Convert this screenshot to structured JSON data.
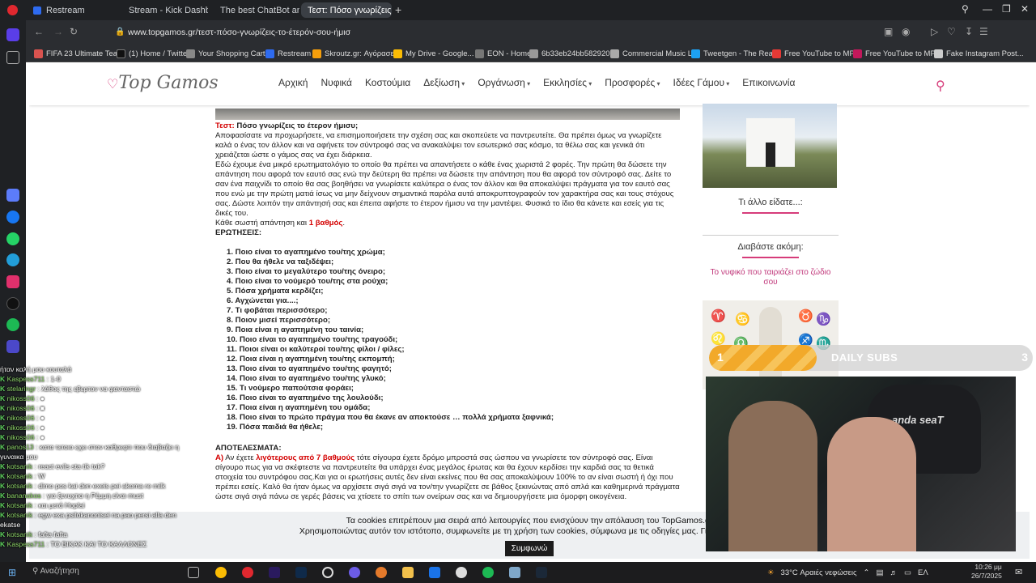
{
  "browser": {
    "tabs": [
      {
        "label": "Restream",
        "color": "#2e6bf0"
      },
      {
        "label": "Stream - Kick Dashboard",
        "color": "#53fc18"
      },
      {
        "label": "The best ChatBot and Wi",
        "color": "#ffffff"
      },
      {
        "label": "Τεστ: Πόσο γνωρίζεις το",
        "color": "#e33e7a"
      }
    ],
    "new_tab_glyph": "+",
    "url": "www.topgamos.gr/τεστ-πόσο-γνωρίζεις-το-έτερόν-σου-ήμισ",
    "bookmarks": [
      {
        "label": "FIFA 23 Ultimate Tea...",
        "color": "#d9534f"
      },
      {
        "label": "(1) Home / Twitter",
        "color": "#111111"
      },
      {
        "label": "Your Shopping Cart...",
        "color": "#888888"
      },
      {
        "label": "Restream",
        "color": "#2e6bf0"
      },
      {
        "label": "Skroutz.gr: Αγόρασε...",
        "color": "#f59e0b"
      },
      {
        "label": "My Drive - Google...",
        "color": "#fbbc04"
      },
      {
        "label": "EON - Home",
        "color": "#777777"
      },
      {
        "label": "6b33eb24bb582920...",
        "color": "#999999"
      },
      {
        "label": "Commercial Music L...",
        "color": "#aaaaaa"
      },
      {
        "label": "Tweetgen - The Real...",
        "color": "#1da1f2"
      },
      {
        "label": "Free YouTube to MP...",
        "color": "#e53935"
      },
      {
        "label": "Free YouTube to MP...",
        "color": "#c2185b"
      },
      {
        "label": "Fake Instagram Post...",
        "color": "#cccccc"
      }
    ]
  },
  "site": {
    "logo": "Top Gamos",
    "nav": [
      "Αρχική",
      "Νυφικά",
      "Κοστούμια",
      "Δεξίωση",
      "Οργάνωση",
      "Εκκλησίες",
      "Προσφορές",
      "Ιδέες Γάμου",
      "Επικοινωνία"
    ],
    "article": {
      "title_prefix": "Τεστ:",
      "title": "Πόσο γνωρίζεις το έτερον ήμισυ;",
      "paragraph1": "Αποφασίσατε να προχωρήσετε, να επισημοποιήσετε την σχέση σας και σκοπεύετε να παντρευτείτε. Θα πρέπει όμως να γνωρίζετε καλά ο ένας τον άλλον και να αφήνετε τον σύντροφό σας να ανακαλύψει τον εσωτερικό σας κόσμο, τα θέλω σας και γενικά ότι χρειάζεται ώστε ο γάμος σας να έχει διάρκεια.",
      "paragraph2": "Εδώ έχουμε ένα μικρό ερωτηματολόγιο το οποίο θα πρέπει να απαντήσετε ο κάθε ένας χωριστά 2 φορές. Την πρώτη θα δώσετε την απάντηση που αφορά τον εαυτό σας ενώ την δεύτερη θα πρέπει να δώσετε την απάντηση που θα αφορά τον σύντροφό σας. Δείτε το σαν ένα παιχνίδι το οποίο θα σας βοηθήσει να γνωρίσετε καλύτερα ο ένας τον άλλον και θα αποκαλύψει πράγματα για τον εαυτό σας που ενώ με την πρώτη ματιά ίσως να μην δείχνουν σημαντικά παρόλα αυτά αποκρυπτογραφούν τον χαρακτήρα σας και τους στόχους σας. Δώστε λοιπόν την απάντησή σας και έπειτα αφήστε το έτερον ήμισυ να την μαντέψει. Φυσικά το ίδιο θα κάνετε και εσείς για τις δικές του.",
      "score_text": "Κάθε σωστή απάντηση και",
      "score_value": "1 βαθμός",
      "score_end": ".",
      "questions_heading": "ΕΡΩΤΗΣΕΙΣ:",
      "questions": [
        "Ποιο είναι το αγαπημένο του/της χρώμα;",
        "Που θα ήθελε να ταξιδέψει;",
        "Ποιο είναι το μεγαλύτερο του/της όνειρο;",
        "Ποιο είναι το νούμερό του/της στα ρούχα;",
        "Πόσα χρήματα κερδίζει;",
        "Αγχώνεται για....;",
        "Τι φοβάται περισσότερο;",
        "Ποιον μισεί περισσότερο;",
        "Ποια είναι η αγαπημένη του ταινία;",
        "Ποιο είναι το αγαπημένο του/της τραγούδι;",
        "Ποιοι είναι οι καλύτεροί του/της φίλοι / φίλες;",
        "Ποια είναι η αγαπημένη του/της εκπομπή;",
        "Ποιο είναι το αγαπημένο του/της φαγητό;",
        "Ποιο είναι το αγαπημένο του/της γλυκό;",
        "Τι νούμερο παπούτσια φοράει;",
        "Ποιο είναι το αγαπημένο της λουλούδι;",
        "Ποια είναι η αγαπημένη του ομάδα;",
        "Ποιο είναι το πρώτο πράγμα που θα έκανε αν αποκτούσε … πολλά χρήματα ξαφνικά;",
        "Πόσα παιδιά θα ήθελε;"
      ],
      "results_heading": "ΑΠΟΤΕΛΕΣΜΑΤΑ:",
      "result_a_label": "Α)",
      "result_a_pre": "Αν έχετε",
      "result_a_highlight": "λιγότερους από 7 βαθμούς",
      "result_a_text": "τότε σίγουρα έχετε δρόμο μπροστά σας ώσπου να γνωρίσετε τον σύντροφό σας. Είναι σίγουρο πως για να σκέφτεστε να παντρευτείτε θα υπάρχει ένας μεγάλος έρωτας και θα έχουν κερδίσει την καρδιά σας τα θετικά στοιχεία του συντρόφου σας.Και για οι ερωτήσεις αυτές δεν είναι εκείνες που θα σας αποκαλύψουν 100% το αν είναι σωστή ή όχι που πρέπει εσείς. Καλό θα ήταν όμως να αρχίσετε σιγά σιγά να τον/την γνωρίζετε σε βάθος ξεκινώντας από απλά και καθημερινά πράγματα ώστε σιγά σιγά πάνω σε γερές βάσεις να χτίσετε το σπίτι των ονείρων σας και να δημιουργήσετε μια όμορφη οικογένεια."
    },
    "sidebar": {
      "other_title": "Τι άλλο είδατε...:",
      "read_more_title": "Διαβάστε ακόμη:",
      "read_more_link": "Το νυφικό που ταιριάζει στο ζώδιο σου"
    },
    "cookie_text_1": "Τα cookies επιτρέπουν μια σειρά από λειτουργίες που ενισχύουν την απόλαυση του TopGamos.gr",
    "cookie_text_2": "Χρησιμοποιώντας αυτόν τον ιστότοπο, συμφωνείτε με τη χρήση των cookies, σύμφωνα με τις οδηγίες μας. Για να μάθετε π",
    "cookie_accept": "Συμφωνώ"
  },
  "overlay": {
    "subs_current": "1",
    "subs_label": "DAILY SUBS",
    "subs_goal": "3",
    "subs_fraction": 0.333,
    "webcam_chair_brand": "anda seaT",
    "chat": [
      {
        "user": "",
        "text": "ήταν καλή μου κουταλά"
      },
      {
        "user": "Kaspess711",
        "text": "1-0"
      },
      {
        "user": "stelaringr",
        "text": "λάθος της εβερτον να φανταστώ"
      },
      {
        "user": "nikoss06",
        "text": "●"
      },
      {
        "user": "nikoss06",
        "text": "■"
      },
      {
        "user": "nikoss06",
        "text": "●"
      },
      {
        "user": "nikoss06",
        "text": "●"
      },
      {
        "user": "nikoss06",
        "text": "●"
      },
      {
        "user": "panos13",
        "text": "κατα τετοιο εχει στον καθρεφτι που διαβαζει η γυναικα μου"
      },
      {
        "user": "kotsanik",
        "text": "react evils sta tik tok?"
      },
      {
        "user": "kotsanik",
        "text": "W"
      },
      {
        "user": "kotsanik",
        "text": "dimo pos kai den exeis pei akoma re milk"
      },
      {
        "user": "bananakos",
        "text": "για ξενυχτια η Ρέμμη είναι must"
      },
      {
        "user": "kotsanik",
        "text": "και μετά Hoplai"
      },
      {
        "user": "kotsanik",
        "text": "egw exa psilokanonisei na pao persi alla den ekatse"
      },
      {
        "user": "kotsanik",
        "text": "fafta fafta"
      },
      {
        "user": "Kaspess711",
        "text": "ΤΟ ΒΙΚΑΚ ΚΑΙ ΤΟ ΚΑΛΛΟΝΕΣ"
      }
    ]
  },
  "taskbar": {
    "search_placeholder": "Αναζήτηση",
    "weather": "33°C  Αραιές νεφώσεις",
    "lang": "ΕΛ",
    "time": "10:26 μμ",
    "date": "26/7/2025"
  }
}
